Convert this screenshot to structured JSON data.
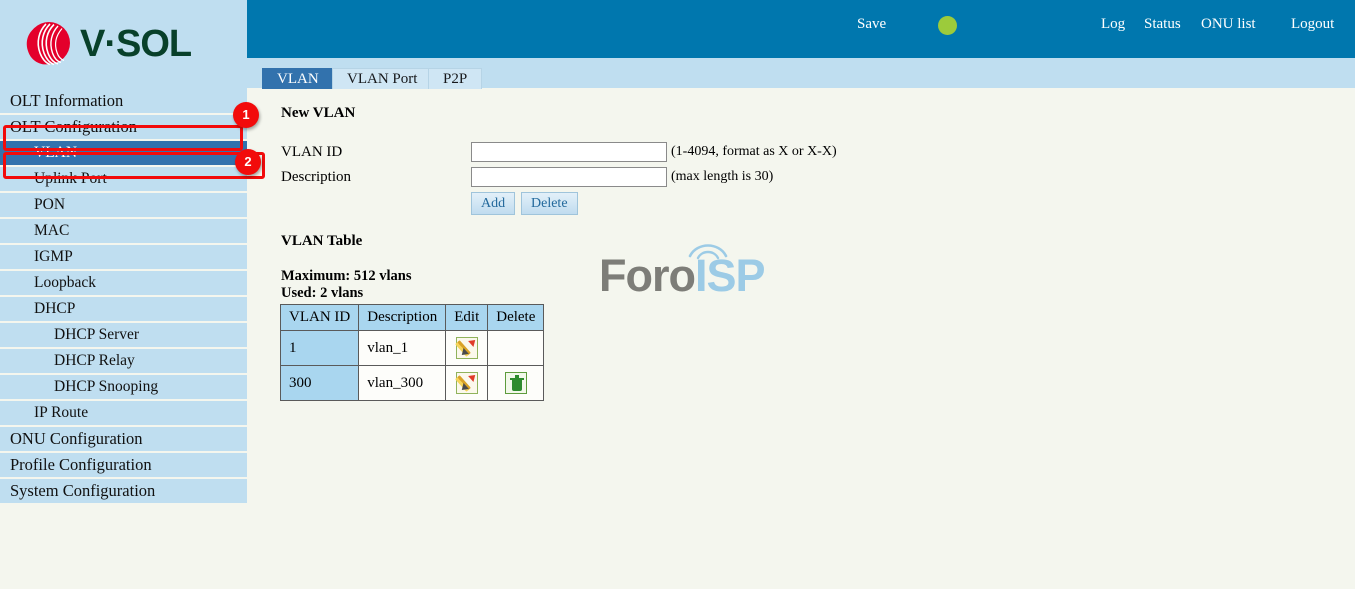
{
  "brand": {
    "logo_text": "V·SOL",
    "logo_mark": "vsol-swoosh-icon"
  },
  "topbar": {
    "save_label": "Save",
    "status_dot": "status-indicator-green",
    "status_dot_color": "#9ccb3b",
    "links": [
      {
        "label": "Log"
      },
      {
        "label": "Status"
      },
      {
        "label": "ONU list"
      },
      {
        "label": "Logout"
      }
    ],
    "background_color": "#0077ae"
  },
  "tabs": [
    {
      "label": "VLAN",
      "selected": true
    },
    {
      "label": "VLAN Port",
      "selected": false
    },
    {
      "label": "P2P",
      "selected": false
    }
  ],
  "sidebar": {
    "items": [
      {
        "label": "OLT Information",
        "level": 1,
        "active": false
      },
      {
        "label": "OLT Configuration",
        "level": 1,
        "active": false
      },
      {
        "label": "VLAN",
        "level": 2,
        "active": true
      },
      {
        "label": "Uplink Port",
        "level": 2,
        "active": false
      },
      {
        "label": "PON",
        "level": 2,
        "active": false
      },
      {
        "label": "MAC",
        "level": 2,
        "active": false
      },
      {
        "label": "IGMP",
        "level": 2,
        "active": false
      },
      {
        "label": "Loopback",
        "level": 2,
        "active": false
      },
      {
        "label": "DHCP",
        "level": 2,
        "active": false
      },
      {
        "label": "DHCP Server",
        "level": 3,
        "active": false
      },
      {
        "label": "DHCP Relay",
        "level": 3,
        "active": false
      },
      {
        "label": "DHCP Snooping",
        "level": 3,
        "active": false
      },
      {
        "label": "IP Route",
        "level": 2,
        "active": false
      },
      {
        "label": "ONU Configuration",
        "level": 1,
        "active": false
      },
      {
        "label": "Profile Configuration",
        "level": 1,
        "active": false
      },
      {
        "label": "System Configuration",
        "level": 1,
        "active": false
      }
    ]
  },
  "annotations": {
    "color": "#f20b0b",
    "badges": [
      {
        "number": "1",
        "target": "OLT Configuration"
      },
      {
        "number": "2",
        "target": "VLAN"
      }
    ]
  },
  "main": {
    "new_vlan_heading": "New VLAN",
    "fields": {
      "vlan_id": {
        "label": "VLAN ID",
        "value": "",
        "placeholder": "",
        "hint": "(1-4094, format as X or X-X)"
      },
      "description": {
        "label": "Description",
        "value": "",
        "placeholder": "",
        "hint": "(max length is 30)"
      }
    },
    "buttons": {
      "add": "Add",
      "delete": "Delete"
    },
    "vlan_table_heading": "VLAN Table",
    "maximum_text": "Maximum: 512 vlans",
    "used_text": "Used: 2 vlans",
    "table": {
      "columns": [
        "VLAN ID",
        "Description",
        "Edit",
        "Delete"
      ],
      "rows": [
        {
          "vlan_id": "1",
          "description": "vlan_1",
          "edit": true,
          "delete": false
        },
        {
          "vlan_id": "300",
          "description": "vlan_300",
          "edit": true,
          "delete": true
        }
      ]
    }
  },
  "watermark": {
    "part1": "Foro",
    "part2": "ISP",
    "part1_color": "#7d7d78",
    "part2_color": "#9ccbe6"
  }
}
